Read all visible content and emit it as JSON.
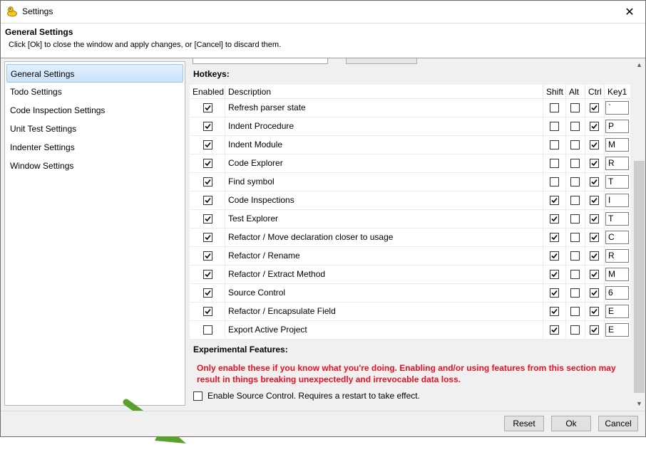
{
  "window": {
    "title": "Settings",
    "close_glyph": "✕"
  },
  "header": {
    "title": "General Settings",
    "subtitle": "Click [Ok] to close the window and apply changes, or [Cancel] to discard them."
  },
  "sidebar": {
    "items": [
      {
        "label": "General Settings",
        "selected": true
      },
      {
        "label": "Todo Settings"
      },
      {
        "label": "Code Inspection Settings"
      },
      {
        "label": "Unit Test Settings"
      },
      {
        "label": "Indenter Settings"
      },
      {
        "label": "Window Settings"
      }
    ]
  },
  "hotkeys": {
    "section_label": "Hotkeys:",
    "columns": {
      "enabled": "Enabled",
      "description": "Description",
      "shift": "Shift",
      "alt": "Alt",
      "ctrl": "Ctrl",
      "key1": "Key1"
    },
    "rows": [
      {
        "enabled": true,
        "description": "Refresh parser state",
        "shift": false,
        "alt": false,
        "ctrl": true,
        "key1": "`"
      },
      {
        "enabled": true,
        "description": "Indent Procedure",
        "shift": false,
        "alt": false,
        "ctrl": true,
        "key1": "P"
      },
      {
        "enabled": true,
        "description": "Indent Module",
        "shift": false,
        "alt": false,
        "ctrl": true,
        "key1": "M"
      },
      {
        "enabled": true,
        "description": "Code Explorer",
        "shift": false,
        "alt": false,
        "ctrl": true,
        "key1": "R"
      },
      {
        "enabled": true,
        "description": "Find symbol",
        "shift": false,
        "alt": false,
        "ctrl": true,
        "key1": "T"
      },
      {
        "enabled": true,
        "description": "Code Inspections",
        "shift": true,
        "alt": false,
        "ctrl": true,
        "key1": "I"
      },
      {
        "enabled": true,
        "description": "Test Explorer",
        "shift": true,
        "alt": false,
        "ctrl": true,
        "key1": "T"
      },
      {
        "enabled": true,
        "description": "Refactor / Move declaration closer to usage",
        "shift": true,
        "alt": false,
        "ctrl": true,
        "key1": "C"
      },
      {
        "enabled": true,
        "description": "Refactor / Rename",
        "shift": true,
        "alt": false,
        "ctrl": true,
        "key1": "R"
      },
      {
        "enabled": true,
        "description": "Refactor / Extract Method",
        "shift": true,
        "alt": false,
        "ctrl": true,
        "key1": "M"
      },
      {
        "enabled": true,
        "description": "Source Control",
        "shift": true,
        "alt": false,
        "ctrl": true,
        "key1": "6"
      },
      {
        "enabled": true,
        "description": "Refactor / Encapsulate Field",
        "shift": true,
        "alt": false,
        "ctrl": true,
        "key1": "E"
      },
      {
        "enabled": false,
        "description": "Export Active Project",
        "shift": true,
        "alt": false,
        "ctrl": true,
        "key1": "E"
      }
    ]
  },
  "experimental": {
    "section_label": "Experimental Features:",
    "warning": "Only enable these if you know what you're doing. Enabling and/or using features from this section may result in things breaking unexpectedly and irrevocable data loss.",
    "source_control_label": "Enable Source Control. Requires a restart to take effect.",
    "source_control_enabled": false
  },
  "footer": {
    "reset": "Reset",
    "ok": "Ok",
    "cancel": "Cancel"
  },
  "colors": {
    "warning": "#e81123",
    "arrow": "#5aa02c",
    "selected_bg": "#cce4fa"
  },
  "icons": {
    "app": "duck-icon",
    "close": "close-icon",
    "check": "checkmark-icon",
    "arrow": "green-arrow-icon"
  }
}
